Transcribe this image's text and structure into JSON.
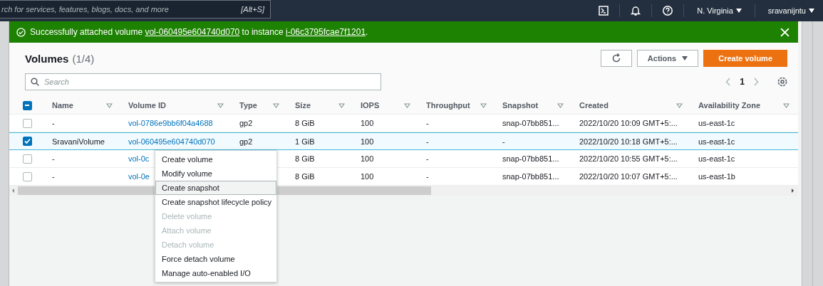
{
  "top_bar": {
    "search_placeholder": "rch for services, features, blogs, docs, and more",
    "shortcut": "[Alt+S]",
    "region": "N. Virginia",
    "user": "sravanijntu"
  },
  "banner": {
    "prefix": "Successfully attached volume",
    "volume_link": "vol-060495e604740d070",
    "middle": "to instance",
    "instance_link": "i-06c3795fcae7f1201",
    "suffix": "."
  },
  "header": {
    "title": "Volumes",
    "count": "(1/4)",
    "actions_label": "Actions",
    "create_label": "Create volume",
    "search_placeholder": "Search",
    "page": "1"
  },
  "select_all": {
    "indeterminate": true
  },
  "columns": [
    "Name",
    "Volume ID",
    "Type",
    "Size",
    "IOPS",
    "Throughput",
    "Snapshot",
    "Created",
    "Availability Zone"
  ],
  "rows": [
    {
      "checked": false,
      "selected": false,
      "cells": [
        "-",
        "vol-0786e9bb6f04a4688",
        "gp2",
        "8 GiB",
        "100",
        "-",
        "snap-07bb851...",
        "2022/10/20 10:09 GMT+5:...",
        "us-east-1c"
      ]
    },
    {
      "checked": true,
      "selected": true,
      "cells": [
        "SravaniVolume",
        "vol-060495e604740d070",
        "gp2",
        "1 GiB",
        "100",
        "-",
        "-",
        "2022/10/20 10:18 GMT+5:...",
        "us-east-1c"
      ]
    },
    {
      "checked": false,
      "selected": false,
      "cells": [
        "-",
        "vol-0c",
        null,
        "8 GiB",
        "100",
        "-",
        "snap-07bb851...",
        "2022/10/20 10:55 GMT+5:...",
        "us-east-1c"
      ]
    },
    {
      "checked": false,
      "selected": false,
      "cells": [
        "-",
        "vol-0e",
        null,
        "8 GiB",
        "100",
        "-",
        "snap-07bb851...",
        "2022/10/20 10:07 GMT+5:...",
        "us-east-1b"
      ]
    }
  ],
  "menu": [
    {
      "label": "Create volume",
      "disabled": false,
      "selected": false
    },
    {
      "label": "Modify volume",
      "disabled": false,
      "selected": false
    },
    {
      "label": "Create snapshot",
      "disabled": false,
      "selected": true
    },
    {
      "label": "Create snapshot lifecycle policy",
      "disabled": false,
      "selected": false
    },
    {
      "label": "Delete volume",
      "disabled": true,
      "selected": false
    },
    {
      "label": "Attach volume",
      "disabled": true,
      "selected": false
    },
    {
      "label": "Detach volume",
      "disabled": true,
      "selected": false
    },
    {
      "label": "Force detach volume",
      "disabled": false,
      "selected": false
    },
    {
      "label": "Manage auto-enabled I/O",
      "disabled": false,
      "selected": false
    }
  ]
}
